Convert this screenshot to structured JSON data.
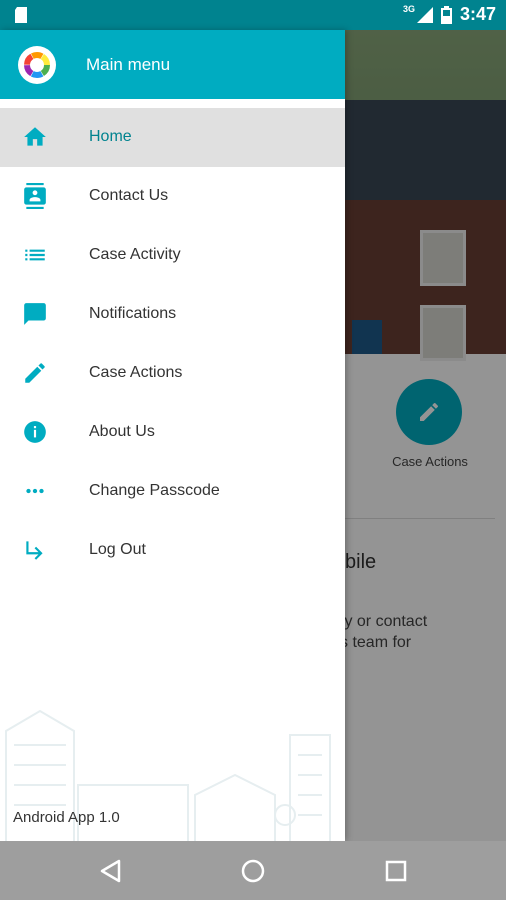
{
  "status_bar": {
    "network": "3G",
    "time": "3:47"
  },
  "drawer": {
    "title": "Main menu",
    "items": [
      {
        "label": "Home",
        "icon": "home-icon",
        "active": true
      },
      {
        "label": "Contact Us",
        "icon": "contact-card-icon",
        "active": false
      },
      {
        "label": "Case Activity",
        "icon": "list-icon",
        "active": false
      },
      {
        "label": "Notifications",
        "icon": "chat-bubble-icon",
        "active": false
      },
      {
        "label": "Case Actions",
        "icon": "pencil-icon",
        "active": false
      },
      {
        "label": "About Us",
        "icon": "info-icon",
        "active": false
      },
      {
        "label": "Change Passcode",
        "icon": "more-horizontal-icon",
        "active": false
      },
      {
        "label": "Log Out",
        "icon": "subdirectory-arrow-icon",
        "active": false
      }
    ],
    "version": "Android App 1.0"
  },
  "background": {
    "action_label": "Case Actions",
    "cut_label": "e",
    "heading_fragment": "bile",
    "text_line1": "ty or contact",
    "text_line2": "s team for"
  },
  "colors": {
    "accent": "#00acc1",
    "status_bar": "#00838f",
    "nav_bar": "#9e9e9e",
    "active_bg": "#e0e0e0"
  }
}
